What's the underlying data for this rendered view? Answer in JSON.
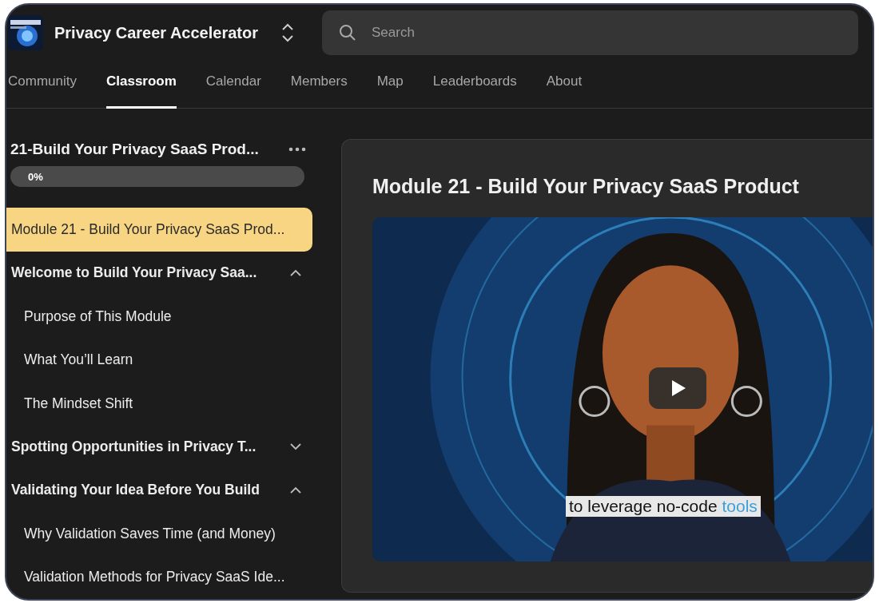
{
  "header": {
    "title": "Privacy Career Accelerator",
    "search": {
      "placeholder": "Search"
    }
  },
  "tabs": [
    {
      "label": "Community",
      "selected": false
    },
    {
      "label": "Classroom",
      "selected": true
    },
    {
      "label": "Calendar",
      "selected": false
    },
    {
      "label": "Members",
      "selected": false
    },
    {
      "label": "Map",
      "selected": false
    },
    {
      "label": "Leaderboards",
      "selected": false
    },
    {
      "label": "About",
      "selected": false
    }
  ],
  "sidebar": {
    "course_title": "21-Build Your Privacy SaaS Prod...",
    "progress": {
      "level": 0,
      "reading": "0%"
    },
    "items": [
      {
        "kind": "lesson",
        "label": "Module 21 - Build Your Privacy SaaS Prod...",
        "selected": true
      },
      {
        "kind": "section",
        "label": "Welcome to Build Your Privacy Saa...",
        "expanded": true,
        "children": [
          {
            "kind": "lesson",
            "label": "Purpose of This Module",
            "selected": false
          },
          {
            "kind": "lesson",
            "label": "What You’ll Learn",
            "selected": false
          },
          {
            "kind": "lesson",
            "label": "The Mindset Shift",
            "selected": false
          }
        ]
      },
      {
        "kind": "section",
        "label": "Spotting Opportunities in Privacy T...",
        "expanded": false
      },
      {
        "kind": "section",
        "label": "Validating Your Idea Before You Build",
        "expanded": true,
        "children": [
          {
            "kind": "lesson",
            "label": "Why Validation Saves Time (and Money)",
            "selected": false
          },
          {
            "kind": "lesson",
            "label": "Validation Methods for Privacy SaaS Ide...",
            "selected": false
          }
        ]
      }
    ]
  },
  "lesson": {
    "title": "Module 21 - Build Your Privacy SaaS Product",
    "video": {
      "kind": "picture",
      "caption": "to leverage no-code",
      "caption_highlight": "tools"
    }
  }
}
